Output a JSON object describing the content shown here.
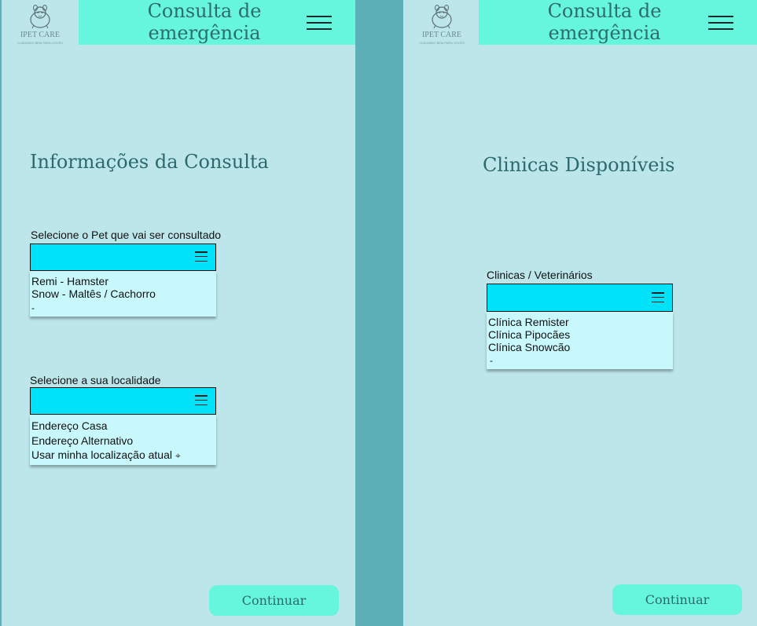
{
  "brand": {
    "name": "IPET CARE",
    "tagline": "CUIDANDO BEM PARA VOCÊS"
  },
  "screens": [
    {
      "header_title_line1": "Consulta de",
      "header_title_line2": "emergência",
      "section_title": "Informações da Consulta",
      "pet_select": {
        "label": "Selecione o Pet que vai ser consultado",
        "options": [
          "Remi  - Hamster",
          "Snow - Maltês / Cachorro"
        ],
        "trailing": "-"
      },
      "location_select": {
        "label": "Selecione a sua localidade",
        "options": [
          "Endereço Casa",
          "Endereço Alternativo",
          "Usar minha localização atual"
        ]
      },
      "continue_label": "Continuar"
    },
    {
      "header_title_line1": "Consulta de",
      "header_title_line2": "emergência",
      "section_title": "Clinicas Disponíveis",
      "clinic_select": {
        "label": "Clinicas / Veterinários",
        "options": [
          "Clínica Remister",
          "Clínica Pipocães",
          "Clínica Snowcão"
        ],
        "trailing": "-"
      },
      "continue_label": "Continuar"
    }
  ],
  "colors": {
    "header": "#66f5dd",
    "screen_bg": "#bce6ea",
    "dropdown_head": "#00e2f8",
    "dropdown_list": "#c8f8fc",
    "divider": "#5eb0b8"
  },
  "icons": {
    "menu": "hamburger-icon",
    "dropdown": "list-icon",
    "location": "crosshair-icon",
    "logo": "hamster-icon"
  }
}
